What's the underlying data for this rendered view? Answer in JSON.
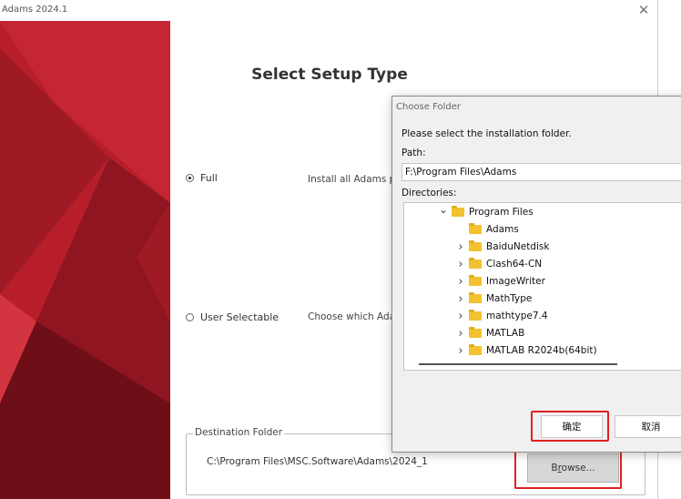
{
  "window": {
    "title": "Adams 2024.1",
    "close_glyph": "✕"
  },
  "banner": {
    "colors": [
      "#b81e2a",
      "#8f1520",
      "#d23440",
      "#6e0e17",
      "#c42633",
      "#a01a26"
    ]
  },
  "setup": {
    "heading": "Select Setup Type",
    "options": [
      {
        "label": "Full",
        "selected": true,
        "description": "Install all Adams pr"
      },
      {
        "label": "User Selectable",
        "selected": false,
        "description": "Choose which Ada"
      }
    ],
    "destination": {
      "legend": "Destination Folder",
      "path": "C:\\Program Files\\MSC.Software\\Adams\\2024_1",
      "browse_label": "Browse...",
      "browse_mnemonic": "r"
    }
  },
  "dialog": {
    "title": "Choose Folder",
    "prompt": "Please select the installation folder.",
    "path_label": "Path:",
    "path_value": "F:\\Program Files\\Adams",
    "directories_label": "Directories:",
    "tree": [
      {
        "name": "Program Files",
        "depth": 0,
        "expanded": true,
        "has_children": true
      },
      {
        "name": "Adams",
        "depth": 1,
        "expanded": false,
        "has_children": false
      },
      {
        "name": "BaiduNetdisk",
        "depth": 1,
        "expanded": false,
        "has_children": true
      },
      {
        "name": "Clash64-CN",
        "depth": 1,
        "expanded": false,
        "has_children": true
      },
      {
        "name": "ImageWriter",
        "depth": 1,
        "expanded": false,
        "has_children": true
      },
      {
        "name": "MathType",
        "depth": 1,
        "expanded": false,
        "has_children": true
      },
      {
        "name": "mathtype7.4",
        "depth": 1,
        "expanded": false,
        "has_children": true
      },
      {
        "name": "MATLAB",
        "depth": 1,
        "expanded": false,
        "has_children": true
      },
      {
        "name": "MATLAB R2024b(64bit)",
        "depth": 1,
        "expanded": false,
        "has_children": true
      }
    ],
    "ok_label": "确定",
    "cancel_label": "取消"
  },
  "highlight_color": "#e02020"
}
